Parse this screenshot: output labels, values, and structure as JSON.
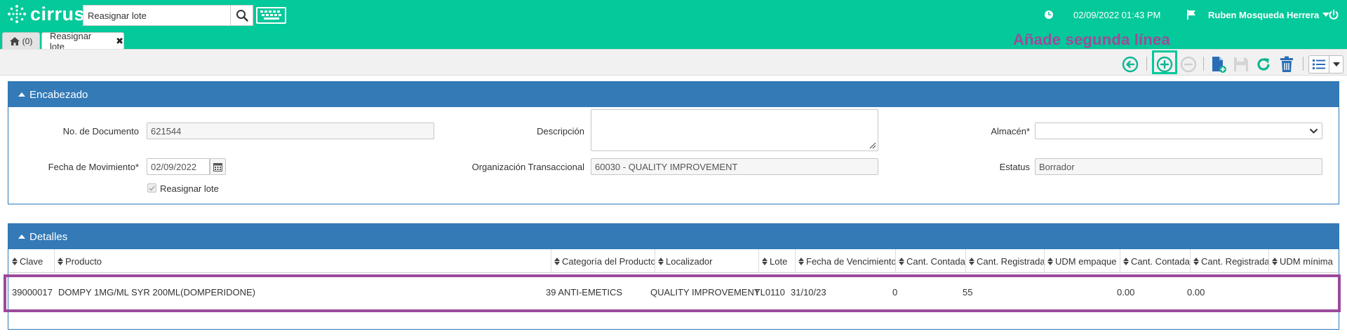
{
  "app": {
    "brand": "cirrus",
    "search_placeholder": "Reasignar lote",
    "datetime": "02/09/2022 01:43 PM",
    "username": "Ruben Mosqueda Herrera"
  },
  "tabs": {
    "home_label": "(0)",
    "active_label": "Reasignar lote"
  },
  "annotation": {
    "label": "Añade segunda línea"
  },
  "encabezado": {
    "title": "Encabezado",
    "documento_label": "No. de Documento",
    "documento_value": "621544",
    "fecha_label": "Fecha de Movimiento*",
    "fecha_value": "02/09/2022",
    "reasignar_label": "Reasignar lote",
    "descripcion_label": "Descripción",
    "descripcion_value": "",
    "organizacion_label": "Organización Transaccional",
    "organizacion_value": "60030 - QUALITY IMPROVEMENT",
    "almacen_label": "Almacén*",
    "almacen_value": "",
    "estatus_label": "Estatus",
    "estatus_value": "Borrador"
  },
  "detalles": {
    "title": "Detalles",
    "columns": [
      "Clave",
      "Producto",
      "Categoría del Producto",
      "Localizador",
      "Lote",
      "Fecha de Vencimiento",
      "Cant. Contada",
      "Cant. Registrada",
      "UDM empaque",
      "Cant. Contada",
      "Cant. Registrada",
      "UDM mínima"
    ],
    "rows": [
      {
        "clave": "39000017",
        "producto": "DOMPY 1MG/ML SYR 200ML(DOMPERIDONE)",
        "categoria": "39 ANTI-EMETICS",
        "localizador": "QUALITY IMPROVEMENT",
        "lote": "YL0110",
        "fecha": "31/10/23",
        "cant_contada": "0",
        "cant_registrada": "55",
        "udm_empaque": "",
        "cant_contada2": "0.00",
        "cant_registrada2": "0.00",
        "udm_minima": ""
      }
    ]
  },
  "colors": {
    "brand_green": "#04c99a",
    "panel_blue": "#337ab7",
    "annotation_purple": "#9b4a9b",
    "icon_teal": "#0fb592",
    "icon_blue": "#2a6db5"
  }
}
